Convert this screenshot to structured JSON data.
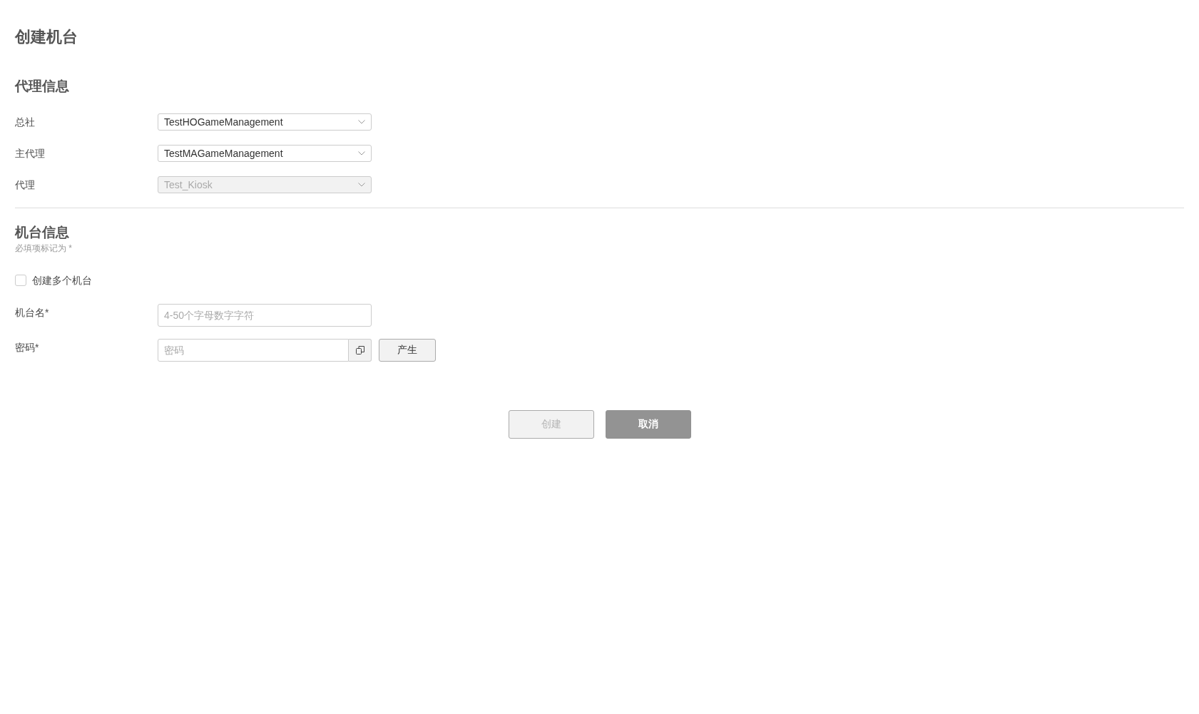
{
  "page": {
    "title": "创建机台"
  },
  "agent_section": {
    "title": "代理信息",
    "fields": [
      {
        "label": "总社",
        "value": "TestHOGameManagement",
        "disabled": false
      },
      {
        "label": "主代理",
        "value": "TestMAGameManagement",
        "disabled": false
      },
      {
        "label": "代理",
        "value": "Test_Kiosk",
        "disabled": true
      }
    ]
  },
  "machine_section": {
    "title": "机台信息",
    "note": "必填项标记为 *",
    "multi_checkbox": {
      "label": "创建多个机台",
      "checked": false
    },
    "fields": [
      {
        "kind": "text",
        "label": "机台名*",
        "placeholder": "4-50个字母数字字符"
      },
      {
        "kind": "password",
        "label": "密码*",
        "placeholder": "密码",
        "generate_button": "产生"
      }
    ]
  },
  "buttons": [
    {
      "label": "创建",
      "kind": "secondary",
      "disabled": true
    },
    {
      "label": "取消",
      "kind": "primary",
      "disabled": false
    }
  ]
}
